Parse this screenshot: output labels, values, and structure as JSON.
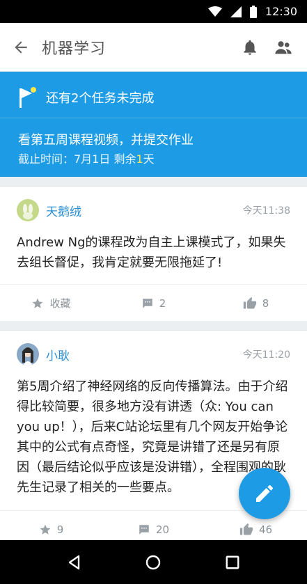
{
  "status_bar": {
    "time": "12:30",
    "icons": [
      "wifi-icon",
      "signal-icon",
      "battery-icon"
    ]
  },
  "app_bar": {
    "title": "机器学习",
    "back_icon": "arrow-left-icon",
    "actions": [
      "bell-icon",
      "people-icon"
    ]
  },
  "banner": {
    "tasks_text": "还有2个任务未完成",
    "task_title": "看第五周课程视频，并提交作业",
    "deadline_prefix": "截止时间：7月1日   剩余",
    "deadline_days": "1",
    "deadline_suffix": "天",
    "color": "#1e9be5"
  },
  "posts": [
    {
      "author": "天鹅绒",
      "time": "今天11:38",
      "text": "Andrew Ng的课程改为自主上课模式了，如果失去组长督促，我肯定就要无限拖延了!",
      "actions": {
        "favorite": "收藏",
        "comments": "2",
        "likes": "8"
      }
    },
    {
      "author": "小耿",
      "time": "今天11:20",
      "text": "第5周介绍了神经网络的反向传播算法。由于介绍得比较简要，很多地方没有讲透（众: You can you up！），后来C站论坛里有几个网友开始争论其中的公式有点奇怪，究竟是讲错了还是另有原因（最后结论似乎应该是没讲错），全程围观的耿先生记录了相关的一些要点。",
      "actions": {
        "favorite": "9",
        "comments": "20",
        "likes": "46"
      }
    }
  ],
  "fab": {
    "icon": "pencil-icon"
  },
  "nav_bar": {
    "icons": [
      "nav-back-icon",
      "nav-home-icon",
      "nav-recents-icon"
    ]
  }
}
